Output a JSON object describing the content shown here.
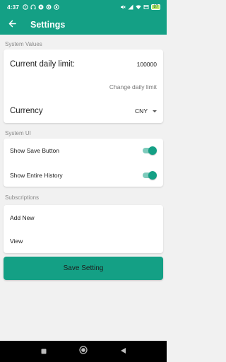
{
  "status_bar": {
    "time": "4:37",
    "battery_level": "87"
  },
  "app_bar": {
    "title": "Settings",
    "back_icon": "arrow-back-icon"
  },
  "system_values": {
    "section_label": "System Values",
    "daily_limit_label": "Current daily limit:",
    "daily_limit_value": "100000",
    "change_limit_link": "Change daily limit",
    "currency_label": "Currency",
    "currency_value": "CNY"
  },
  "system_ui": {
    "section_label": "System UI",
    "show_save_label": "Show Save Button",
    "show_save_on": true,
    "show_history_label": "Show Entire History",
    "show_history_on": true
  },
  "subscriptions": {
    "section_label": "Subscriptions",
    "add_new_label": "Add New",
    "view_label": "View"
  },
  "save_button_label": "Save Setting",
  "colors": {
    "primary": "#14a085",
    "background": "#f1f1f1",
    "card": "#ffffff"
  }
}
